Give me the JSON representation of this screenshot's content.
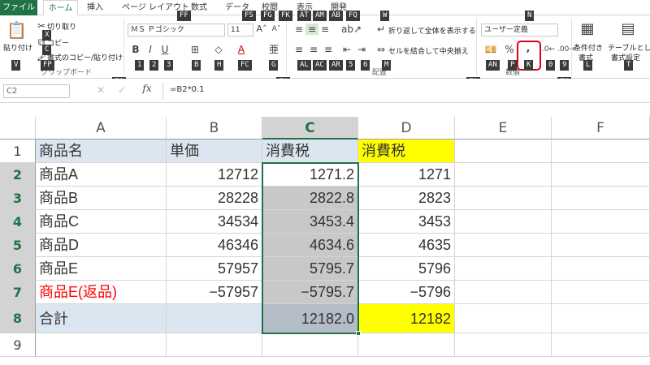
{
  "tabs": {
    "file": "ファイル",
    "home": "ホーム",
    "insert": "挿入",
    "layout": "ページ レイアウト",
    "formulas": "数式",
    "data": "データ",
    "review": "校閲",
    "view": "表示",
    "developer": "開発"
  },
  "keytips": {
    "file": "F",
    "home": "H",
    "insert": "N",
    "layout": "P",
    "formulas": "M",
    "data": "A",
    "review": "R",
    "view": "W",
    "developer": "L",
    "paste": "V",
    "cut": "X",
    "copy": "C",
    "format_painter": "FP",
    "font_name": "FF",
    "font_size": "FS",
    "grow": "FG",
    "shrink": "FK",
    "align_top": "AT",
    "align_middle": "AM",
    "align_bottom": "AB",
    "orientation": "FQ",
    "wrap": "W",
    "number_format": "N",
    "bold": "1",
    "italic": "2",
    "underline": "3",
    "borders": "B",
    "fill": "H",
    "font_color": "FC",
    "phonetic": "G",
    "align_left": "AL",
    "align_center": "AC",
    "align_right": "AR",
    "decrease_indent": "5",
    "increase_indent": "6",
    "merge": "M",
    "accounting": "AN",
    "percent": "P",
    "comma": "K",
    "increase_decimal": "0",
    "decrease_decimal": "9",
    "conditional": "L",
    "table": "T",
    "clipboard_launcher": "FO",
    "font_launcher": "FN",
    "alignment_launcher": "FA",
    "number_launcher": "FM"
  },
  "ribbon": {
    "paste": "貼り付け",
    "cut": "切り取り",
    "copy": "コピー",
    "format_painter": "書式のコピー/貼り付け",
    "clipboard": "クリップボード",
    "font_name": "ＭＳ Ｐゴシック",
    "font_size": "11",
    "wrap": "折り返して全体を表示する",
    "merge": "セルを結合して中央揃え",
    "alignment": "配置",
    "number_format": "ユーザー定義",
    "number": "数値",
    "conditional_1": "条件付き",
    "conditional_2": "書式",
    "table_1": "テーブルとして",
    "table_2": "書式設定"
  },
  "formula_bar": {
    "name_box": "C2",
    "fx": "fx",
    "formula": "=B2*0.1"
  },
  "columns": [
    "A",
    "B",
    "C",
    "D",
    "E",
    "F"
  ],
  "rows": [
    "1",
    "2",
    "3",
    "4",
    "5",
    "6",
    "7",
    "8",
    "9"
  ],
  "cells": {
    "r1": [
      "商品名",
      "単価",
      "消費税",
      "消費税"
    ],
    "r2": [
      "商品A",
      "12712",
      "1271.2",
      "1271"
    ],
    "r3": [
      "商品B",
      "28228",
      "2822.8",
      "2823"
    ],
    "r4": [
      "商品C",
      "34534",
      "3453.4",
      "3453"
    ],
    "r5": [
      "商品D",
      "46346",
      "4634.6",
      "4635"
    ],
    "r6": [
      "商品E",
      "57957",
      "5795.7",
      "5796"
    ],
    "r7": [
      "商品E(返品)",
      "−57957",
      "−5795.7",
      "−5796"
    ],
    "r8": [
      "合計",
      "",
      "12182.0",
      "12182"
    ]
  },
  "colors": {
    "accent": "#217346",
    "header_fill": "#dce6f1",
    "yellow": "#ffff00",
    "red": "#ff0000",
    "selection": "#c8c8c8"
  }
}
